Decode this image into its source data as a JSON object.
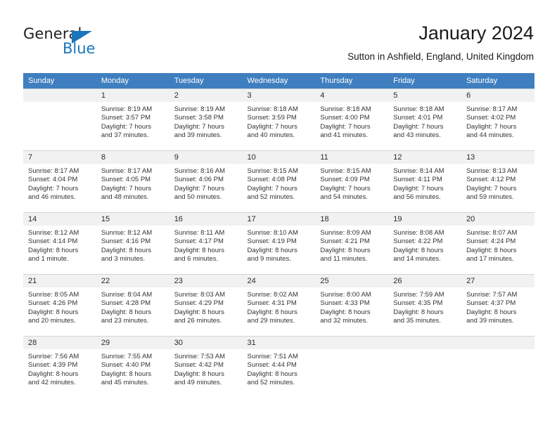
{
  "logo": {
    "word_one": "General",
    "word_two": "Blue",
    "triangle_color": "#1b75bc",
    "text_color": "#231f20"
  },
  "header": {
    "title": "January 2024",
    "subtitle": "Sutton in Ashfield, England, United Kingdom"
  },
  "colors": {
    "header_row_bg": "#3f7fbf",
    "header_row_text": "#ffffff",
    "daynum_band_bg": "#f1f1f1",
    "grid_line": "#d4d4d4",
    "body_text": "#333333"
  },
  "weekday_headers": [
    "Sunday",
    "Monday",
    "Tuesday",
    "Wednesday",
    "Thursday",
    "Friday",
    "Saturday"
  ],
  "weeks": [
    [
      {
        "day": "",
        "sunrise": "",
        "sunset": "",
        "daylight_line1": "",
        "daylight_line2": ""
      },
      {
        "day": "1",
        "sunrise": "Sunrise: 8:19 AM",
        "sunset": "Sunset: 3:57 PM",
        "daylight_line1": "Daylight: 7 hours",
        "daylight_line2": "and 37 minutes."
      },
      {
        "day": "2",
        "sunrise": "Sunrise: 8:19 AM",
        "sunset": "Sunset: 3:58 PM",
        "daylight_line1": "Daylight: 7 hours",
        "daylight_line2": "and 39 minutes."
      },
      {
        "day": "3",
        "sunrise": "Sunrise: 8:18 AM",
        "sunset": "Sunset: 3:59 PM",
        "daylight_line1": "Daylight: 7 hours",
        "daylight_line2": "and 40 minutes."
      },
      {
        "day": "4",
        "sunrise": "Sunrise: 8:18 AM",
        "sunset": "Sunset: 4:00 PM",
        "daylight_line1": "Daylight: 7 hours",
        "daylight_line2": "and 41 minutes."
      },
      {
        "day": "5",
        "sunrise": "Sunrise: 8:18 AM",
        "sunset": "Sunset: 4:01 PM",
        "daylight_line1": "Daylight: 7 hours",
        "daylight_line2": "and 43 minutes."
      },
      {
        "day": "6",
        "sunrise": "Sunrise: 8:17 AM",
        "sunset": "Sunset: 4:02 PM",
        "daylight_line1": "Daylight: 7 hours",
        "daylight_line2": "and 44 minutes."
      }
    ],
    [
      {
        "day": "7",
        "sunrise": "Sunrise: 8:17 AM",
        "sunset": "Sunset: 4:04 PM",
        "daylight_line1": "Daylight: 7 hours",
        "daylight_line2": "and 46 minutes."
      },
      {
        "day": "8",
        "sunrise": "Sunrise: 8:17 AM",
        "sunset": "Sunset: 4:05 PM",
        "daylight_line1": "Daylight: 7 hours",
        "daylight_line2": "and 48 minutes."
      },
      {
        "day": "9",
        "sunrise": "Sunrise: 8:16 AM",
        "sunset": "Sunset: 4:06 PM",
        "daylight_line1": "Daylight: 7 hours",
        "daylight_line2": "and 50 minutes."
      },
      {
        "day": "10",
        "sunrise": "Sunrise: 8:15 AM",
        "sunset": "Sunset: 4:08 PM",
        "daylight_line1": "Daylight: 7 hours",
        "daylight_line2": "and 52 minutes."
      },
      {
        "day": "11",
        "sunrise": "Sunrise: 8:15 AM",
        "sunset": "Sunset: 4:09 PM",
        "daylight_line1": "Daylight: 7 hours",
        "daylight_line2": "and 54 minutes."
      },
      {
        "day": "12",
        "sunrise": "Sunrise: 8:14 AM",
        "sunset": "Sunset: 4:11 PM",
        "daylight_line1": "Daylight: 7 hours",
        "daylight_line2": "and 56 minutes."
      },
      {
        "day": "13",
        "sunrise": "Sunrise: 8:13 AM",
        "sunset": "Sunset: 4:12 PM",
        "daylight_line1": "Daylight: 7 hours",
        "daylight_line2": "and 59 minutes."
      }
    ],
    [
      {
        "day": "14",
        "sunrise": "Sunrise: 8:12 AM",
        "sunset": "Sunset: 4:14 PM",
        "daylight_line1": "Daylight: 8 hours",
        "daylight_line2": "and 1 minute."
      },
      {
        "day": "15",
        "sunrise": "Sunrise: 8:12 AM",
        "sunset": "Sunset: 4:16 PM",
        "daylight_line1": "Daylight: 8 hours",
        "daylight_line2": "and 3 minutes."
      },
      {
        "day": "16",
        "sunrise": "Sunrise: 8:11 AM",
        "sunset": "Sunset: 4:17 PM",
        "daylight_line1": "Daylight: 8 hours",
        "daylight_line2": "and 6 minutes."
      },
      {
        "day": "17",
        "sunrise": "Sunrise: 8:10 AM",
        "sunset": "Sunset: 4:19 PM",
        "daylight_line1": "Daylight: 8 hours",
        "daylight_line2": "and 9 minutes."
      },
      {
        "day": "18",
        "sunrise": "Sunrise: 8:09 AM",
        "sunset": "Sunset: 4:21 PM",
        "daylight_line1": "Daylight: 8 hours",
        "daylight_line2": "and 11 minutes."
      },
      {
        "day": "19",
        "sunrise": "Sunrise: 8:08 AM",
        "sunset": "Sunset: 4:22 PM",
        "daylight_line1": "Daylight: 8 hours",
        "daylight_line2": "and 14 minutes."
      },
      {
        "day": "20",
        "sunrise": "Sunrise: 8:07 AM",
        "sunset": "Sunset: 4:24 PM",
        "daylight_line1": "Daylight: 8 hours",
        "daylight_line2": "and 17 minutes."
      }
    ],
    [
      {
        "day": "21",
        "sunrise": "Sunrise: 8:05 AM",
        "sunset": "Sunset: 4:26 PM",
        "daylight_line1": "Daylight: 8 hours",
        "daylight_line2": "and 20 minutes."
      },
      {
        "day": "22",
        "sunrise": "Sunrise: 8:04 AM",
        "sunset": "Sunset: 4:28 PM",
        "daylight_line1": "Daylight: 8 hours",
        "daylight_line2": "and 23 minutes."
      },
      {
        "day": "23",
        "sunrise": "Sunrise: 8:03 AM",
        "sunset": "Sunset: 4:29 PM",
        "daylight_line1": "Daylight: 8 hours",
        "daylight_line2": "and 26 minutes."
      },
      {
        "day": "24",
        "sunrise": "Sunrise: 8:02 AM",
        "sunset": "Sunset: 4:31 PM",
        "daylight_line1": "Daylight: 8 hours",
        "daylight_line2": "and 29 minutes."
      },
      {
        "day": "25",
        "sunrise": "Sunrise: 8:00 AM",
        "sunset": "Sunset: 4:33 PM",
        "daylight_line1": "Daylight: 8 hours",
        "daylight_line2": "and 32 minutes."
      },
      {
        "day": "26",
        "sunrise": "Sunrise: 7:59 AM",
        "sunset": "Sunset: 4:35 PM",
        "daylight_line1": "Daylight: 8 hours",
        "daylight_line2": "and 35 minutes."
      },
      {
        "day": "27",
        "sunrise": "Sunrise: 7:57 AM",
        "sunset": "Sunset: 4:37 PM",
        "daylight_line1": "Daylight: 8 hours",
        "daylight_line2": "and 39 minutes."
      }
    ],
    [
      {
        "day": "28",
        "sunrise": "Sunrise: 7:56 AM",
        "sunset": "Sunset: 4:39 PM",
        "daylight_line1": "Daylight: 8 hours",
        "daylight_line2": "and 42 minutes."
      },
      {
        "day": "29",
        "sunrise": "Sunrise: 7:55 AM",
        "sunset": "Sunset: 4:40 PM",
        "daylight_line1": "Daylight: 8 hours",
        "daylight_line2": "and 45 minutes."
      },
      {
        "day": "30",
        "sunrise": "Sunrise: 7:53 AM",
        "sunset": "Sunset: 4:42 PM",
        "daylight_line1": "Daylight: 8 hours",
        "daylight_line2": "and 49 minutes."
      },
      {
        "day": "31",
        "sunrise": "Sunrise: 7:51 AM",
        "sunset": "Sunset: 4:44 PM",
        "daylight_line1": "Daylight: 8 hours",
        "daylight_line2": "and 52 minutes."
      },
      {
        "day": "",
        "sunrise": "",
        "sunset": "",
        "daylight_line1": "",
        "daylight_line2": ""
      },
      {
        "day": "",
        "sunrise": "",
        "sunset": "",
        "daylight_line1": "",
        "daylight_line2": ""
      },
      {
        "day": "",
        "sunrise": "",
        "sunset": "",
        "daylight_line1": "",
        "daylight_line2": ""
      }
    ]
  ]
}
